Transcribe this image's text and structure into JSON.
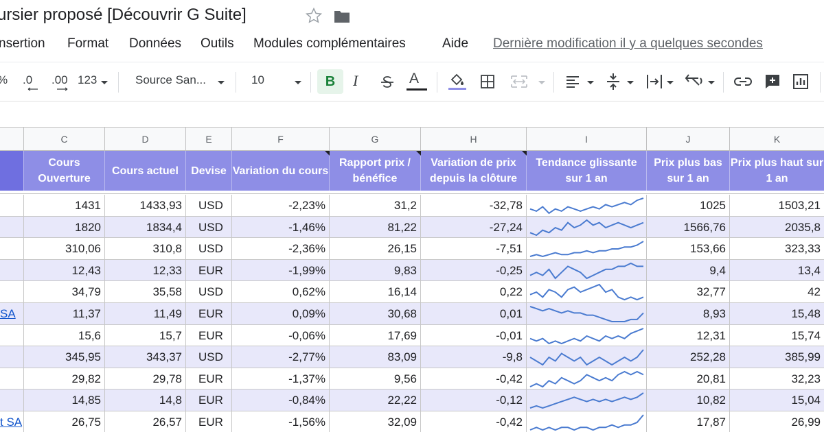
{
  "title": {
    "doc_title": "ursier proposé [Découvrir G Suite]"
  },
  "icons": {
    "star": "star-outline-icon",
    "folder": "folder-icon"
  },
  "menu": {
    "items": [
      "nsertion",
      "Format",
      "Données",
      "Outils",
      "Modules complémentaires",
      "Aide"
    ],
    "last_modified": "Dernière modification il y a quelques secondes"
  },
  "toolbar": {
    "percent": "%",
    "decimal_decrease": ".0",
    "decimal_increase": ".00",
    "number_format": "123",
    "font": "Source San...",
    "font_size": "10",
    "bold": "B",
    "italic": "I",
    "text_color": "A",
    "accent_color": "#188038",
    "bold_bg": "#e6f4ea"
  },
  "columns": {
    "letters": [
      "C",
      "D",
      "E",
      "F",
      "G",
      "H",
      "I",
      "J",
      "K"
    ]
  },
  "table": {
    "headers": [
      "Cours Ouverture",
      "Cours actuel",
      "Devise",
      "Variation du cours",
      "Rapport prix / bénéfice",
      "Variation de prix depuis la clôture",
      "Tendance glissante sur 1 an",
      "Prix plus bas sur 1 an",
      "Prix plus haut sur 1 an"
    ],
    "header_color": "#8e8ee6",
    "alt_row_color": "#e8e8fa",
    "sparkline_color": "#4a7bd0",
    "rows": [
      {
        "left": "",
        "open": "1431",
        "current": "1433,93",
        "currency": "USD",
        "change": "-2,23%",
        "pe": "31,2",
        "close_change": "-32,78",
        "spark": [
          5,
          4,
          6,
          3,
          5,
          4,
          6,
          5,
          4,
          5,
          6,
          5,
          7,
          6,
          7,
          8,
          7,
          9,
          10
        ],
        "low": "1025",
        "high": "1503,21"
      },
      {
        "left": "",
        "open": "1820",
        "current": "1834,4",
        "currency": "USD",
        "change": "-1,46%",
        "pe": "81,22",
        "close_change": "-27,24",
        "spark": [
          4,
          3,
          5,
          4,
          6,
          5,
          8,
          6,
          7,
          9,
          7,
          8,
          6,
          7,
          8,
          7,
          6,
          7,
          8
        ],
        "low": "1566,76",
        "high": "2035,8"
      },
      {
        "left": "",
        "open": "310,06",
        "current": "310,8",
        "currency": "USD",
        "change": "-2,36%",
        "pe": "26,15",
        "close_change": "-7,51",
        "spark": [
          2,
          3,
          2,
          3,
          4,
          3,
          3,
          4,
          4,
          5,
          4,
          5,
          5,
          6,
          6,
          7,
          7,
          8,
          10
        ],
        "low": "153,66",
        "high": "323,33"
      },
      {
        "left": "",
        "open": "12,43",
        "current": "12,33",
        "currency": "EUR",
        "change": "-1,99%",
        "pe": "9,83",
        "close_change": "-0,25",
        "spark": [
          6,
          7,
          6,
          8,
          5,
          7,
          9,
          8,
          7,
          5,
          6,
          7,
          8,
          8,
          9,
          9,
          10,
          9,
          9
        ],
        "low": "9,4",
        "high": "13,4"
      },
      {
        "left": "",
        "open": "34,79",
        "current": "35,58",
        "currency": "USD",
        "change": "0,62%",
        "pe": "16,14",
        "close_change": "0,22",
        "spark": [
          5,
          6,
          4,
          7,
          6,
          4,
          7,
          8,
          6,
          7,
          8,
          9,
          6,
          7,
          4,
          3,
          4,
          3,
          4
        ],
        "low": "32,77",
        "high": "42"
      },
      {
        "left": "SA",
        "open": "11,37",
        "current": "11,49",
        "currency": "EUR",
        "change": "0,09%",
        "pe": "30,68",
        "close_change": "0,01",
        "spark": [
          9,
          8,
          7,
          8,
          7,
          6,
          7,
          6,
          6,
          5,
          5,
          4,
          3,
          2,
          2,
          2,
          3,
          3,
          6
        ],
        "low": "8,93",
        "high": "15,48"
      },
      {
        "left": "",
        "open": "15,6",
        "current": "15,7",
        "currency": "EUR",
        "change": "-0,06%",
        "pe": "17,69",
        "close_change": "-0,01",
        "spark": [
          5,
          4,
          5,
          3,
          4,
          3,
          4,
          5,
          4,
          6,
          5,
          4,
          6,
          5,
          6,
          5,
          7,
          8,
          9
        ],
        "low": "12,31",
        "high": "15,74"
      },
      {
        "left": "",
        "open": "345,95",
        "current": "343,37",
        "currency": "USD",
        "change": "-2,77%",
        "pe": "83,09",
        "close_change": "-9,8",
        "spark": [
          6,
          5,
          4,
          6,
          5,
          7,
          6,
          5,
          6,
          4,
          5,
          6,
          5,
          4,
          5,
          6,
          5,
          6,
          8
        ],
        "low": "252,28",
        "high": "385,99"
      },
      {
        "left": "",
        "open": "29,82",
        "current": "29,78",
        "currency": "EUR",
        "change": "-1,37%",
        "pe": "9,56",
        "close_change": "-0,42",
        "spark": [
          4,
          5,
          4,
          6,
          5,
          7,
          6,
          5,
          6,
          8,
          7,
          6,
          7,
          6,
          8,
          9,
          8,
          9,
          8
        ],
        "low": "20,81",
        "high": "32,23"
      },
      {
        "left": "",
        "open": "14,85",
        "current": "14,8",
        "currency": "EUR",
        "change": "-0,84%",
        "pe": "22,22",
        "close_change": "-0,12",
        "spark": [
          3,
          4,
          3,
          4,
          5,
          6,
          7,
          8,
          7,
          6,
          7,
          6,
          7,
          6,
          7,
          8,
          7,
          8,
          10
        ],
        "low": "10,82",
        "high": "15,04"
      },
      {
        "left": "t SA",
        "open": "26,75",
        "current": "26,57",
        "currency": "EUR",
        "change": "-1,56%",
        "pe": "32,09",
        "close_change": "-0,42",
        "spark": [
          2,
          3,
          2,
          3,
          2,
          3,
          3,
          2,
          3,
          3,
          2,
          3,
          3,
          4,
          3,
          4,
          4,
          5,
          8
        ],
        "low": "17,87",
        "high": "26,99"
      }
    ]
  }
}
